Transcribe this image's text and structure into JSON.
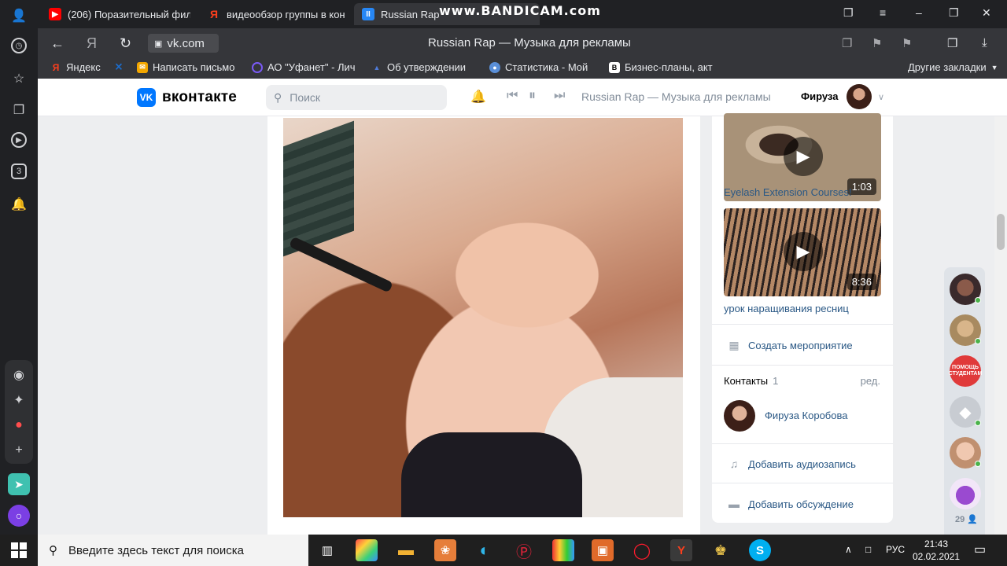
{
  "tabs": [
    {
      "label": "(206) Поразительный фил",
      "favicon": "youtube-icon",
      "color": "#ff0000"
    },
    {
      "label": "видеообзор группы в кон",
      "favicon": "yandex-icon",
      "color": "#fc3f1d"
    },
    {
      "label": "Russian Rap",
      "favicon": "vk-pause-icon",
      "color": "#2787f5"
    }
  ],
  "watermark": "www.BANDICAM.com",
  "address": {
    "url": "vk.com",
    "title": "Russian Rap — Музыка для рекламы"
  },
  "bookmarks": [
    {
      "label": "Яндекс",
      "icon": "yandex-icon",
      "color": "#fc3f1d"
    },
    {
      "label": "",
      "icon": "ufanet-icon",
      "color": "#1b6fd1"
    },
    {
      "label": "Написать письмо",
      "icon": "mail-icon",
      "color": "#f2a600"
    },
    {
      "label": "АО \"Уфанет\" - Лич",
      "icon": "ufanet-ring-icon",
      "color": "#7a5af5"
    },
    {
      "label": "Об утверждении",
      "icon": "doc-icon",
      "color": "#4f7bd9"
    },
    {
      "label": "Статистика - Мой",
      "icon": "stats-icon",
      "color": "#5a8fd8"
    },
    {
      "label": "Бизнес-планы, акт",
      "icon": "b-icon",
      "color": "#3a3a3a"
    }
  ],
  "other_bookmarks": "Другие закладки",
  "vk": {
    "logo": "вконтакте",
    "search_placeholder": "Поиск",
    "now_playing": "Russian Rap — Музыка для рекламы",
    "user_name": "Фируза"
  },
  "sidebar": {
    "videos": [
      {
        "duration": "1:03",
        "title": "Eyelash Extension Courses!"
      },
      {
        "duration": "8:36",
        "title": "урок наращивания ресниц"
      }
    ],
    "create_event": "Создать мероприятие",
    "contacts_label": "Контакты",
    "contacts_count": "1",
    "edit_label": "ред.",
    "contact_name": "Фируза Коробова",
    "add_audio": "Добавить аудиозапись",
    "add_discussion": "Добавить обсуждение"
  },
  "chats": {
    "more_count": "29",
    "badge_text": "ПОМОЩЬ СТУДЕНТАМ"
  },
  "taskbar": {
    "search_placeholder": "Введите здесь текст для поиска",
    "lang": "РУС",
    "time": "21:43",
    "date": "02.02.2021"
  },
  "colors": {
    "vk_blue": "#0077ff",
    "link": "#2a5885",
    "online": "#4bb34b"
  }
}
